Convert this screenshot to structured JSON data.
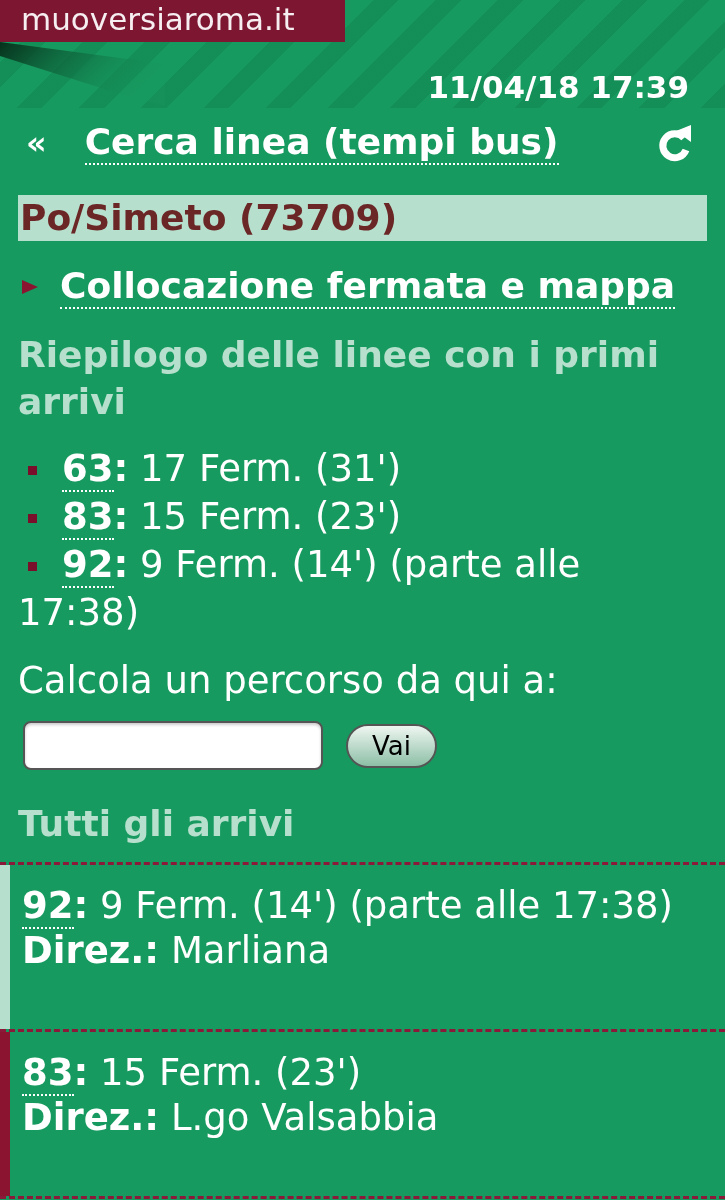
{
  "header": {
    "logo": "muoversiaroma.it",
    "timestamp": "11/04/18 17:39"
  },
  "nav": {
    "back": "«",
    "title": "Cerca linea (tempi bus)"
  },
  "stop": {
    "name": "Po/Simeto (73709)",
    "location_link": "Collocazione fermata e mappa"
  },
  "summary": {
    "title": "Riepilogo delle linee con i primi arrivi",
    "items": [
      {
        "line": "63",
        "text": "**:** 17 Ferm. (31')"
      },
      {
        "line": "83",
        "text": "**:** 15 Ferm. (23')"
      },
      {
        "line": "92",
        "text": "**:** 9 Ferm. (14') (parte alle 17:38)"
      }
    ]
  },
  "route_planner": {
    "label": "Calcola un percorso da qui a:",
    "button": "Vai"
  },
  "arrivals": {
    "title": "Tutti gli arrivi",
    "items": [
      {
        "line": "92",
        "text": "**:** 9 Ferm. (14') (parte alle 17:38)",
        "direction": "**Direz.:** Marliana",
        "color": "#b6e0cd"
      },
      {
        "line": "83",
        "text": "**:** 15 Ferm. (23')",
        "direction": "**Direz.:** L.go Valsabbia",
        "color": "#8b1431"
      }
    ]
  }
}
